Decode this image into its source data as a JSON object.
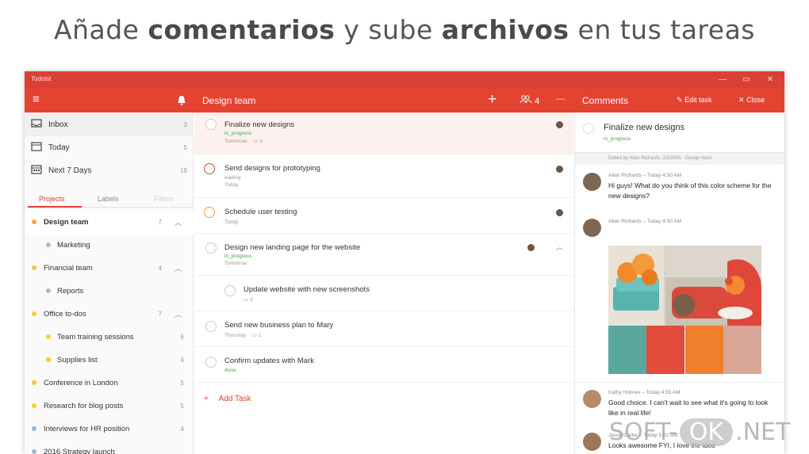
{
  "headline": {
    "p1": "Añade",
    "b1": "comentarios",
    "p2": "y sube",
    "b2": "archivos",
    "p3": "en tus tareas"
  },
  "window": {
    "title": "Todoist"
  },
  "toolbar": {
    "project_title": "Design team",
    "add_glyph": "+",
    "members_count": "4",
    "more_glyph": "—",
    "comments_title": "Comments",
    "edit_task": "Edit task",
    "close": "Close"
  },
  "sidebar": {
    "nav": [
      {
        "label": "Inbox",
        "count": "3",
        "icon": "inbox-icon"
      },
      {
        "label": "Today",
        "count": "5",
        "icon": "today-icon"
      },
      {
        "label": "Next 7 Days",
        "count": "19",
        "icon": "calendar-icon"
      }
    ],
    "tabs": [
      "Projects",
      "Labels",
      "Filters"
    ],
    "projects": [
      {
        "label": "Design team",
        "count": "7",
        "color": "#f4a742",
        "expanded": true
      },
      {
        "label": "Marketing",
        "count": "",
        "color": "#b8b8b8"
      },
      {
        "label": "Financial team",
        "count": "4",
        "color": "#f5c542",
        "expanded": true
      },
      {
        "label": "Reports",
        "count": "",
        "color": "#b8b8b8"
      },
      {
        "label": "Office to-dos",
        "count": "7",
        "color": "#f7cf1f",
        "expanded": true
      },
      {
        "label": "Team training sessions",
        "count": "6",
        "color": "#f7cf1f"
      },
      {
        "label": "Supplies list",
        "count": "4",
        "color": "#f7cf1f"
      },
      {
        "label": "Conference in London",
        "count": "5",
        "color": "#f5c542"
      },
      {
        "label": "Research for blog posts",
        "count": "5",
        "color": "#f7cf1f"
      },
      {
        "label": "Interviews for HR position",
        "count": "4",
        "color": "#9ab8cf"
      },
      {
        "label": "2016 Strategy launch",
        "count": "",
        "color": "#9ab8cf"
      }
    ]
  },
  "tasks": [
    {
      "title": "Finalize new designs",
      "label": "in_progress",
      "date": "Tomorrow",
      "comments": "3",
      "priority": "none",
      "avatar": true
    },
    {
      "title": "Send designs for prototyping",
      "label": "waiting",
      "date": "Today",
      "comments": "",
      "priority": "p1",
      "avatar": true
    },
    {
      "title": "Schedule user testing",
      "label": "",
      "date": "Today",
      "comments": "",
      "priority": "p2",
      "avatar": true
    },
    {
      "title": "Design new landing page for the website",
      "label": "in_progress",
      "date": "Tomorrow",
      "comments": "",
      "priority": "none",
      "avatar": true
    },
    {
      "title": "Update website with new screenshots",
      "label": "",
      "date": "",
      "comments": "3",
      "priority": "none",
      "avatar": false
    },
    {
      "title": "Send new business plan to Mary",
      "label": "",
      "date": "Thursday",
      "comments": "1",
      "priority": "none",
      "avatar": false
    },
    {
      "title": "Confirm updates with Mark",
      "label": "done",
      "date": "",
      "comments": "",
      "priority": "none",
      "avatar": false
    }
  ],
  "add_task": "Add Task",
  "comments_panel": {
    "task_title": "Finalize new designs",
    "task_label": "in_progress",
    "edited_line": "Edited by Allan Richards, 3/3/2016 · Design team",
    "comments": [
      {
        "author_line": "Allan Richards – Today 4:50 AM",
        "text": "Hi guys! What do you think of this color scheme for the new designs?"
      },
      {
        "author_line": "Allan Richards – Today 4:50 AM",
        "text": ""
      },
      {
        "author_line": "Kathy Holmes – Today 4:55 AM",
        "text": "Good choice. I can't wait to see what it's going to look like in real life!"
      },
      {
        "author_line": "Jason Carter – Today 5:02 AM",
        "text": "Looks awesome FYI, I love the idea"
      }
    ],
    "swatch_colors": [
      "#5aa89d",
      "#e34b3b",
      "#f07e2a",
      "#d9a597"
    ]
  },
  "watermark": {
    "left": "SOFT-",
    "ok": "OK",
    "right": ".NET"
  }
}
